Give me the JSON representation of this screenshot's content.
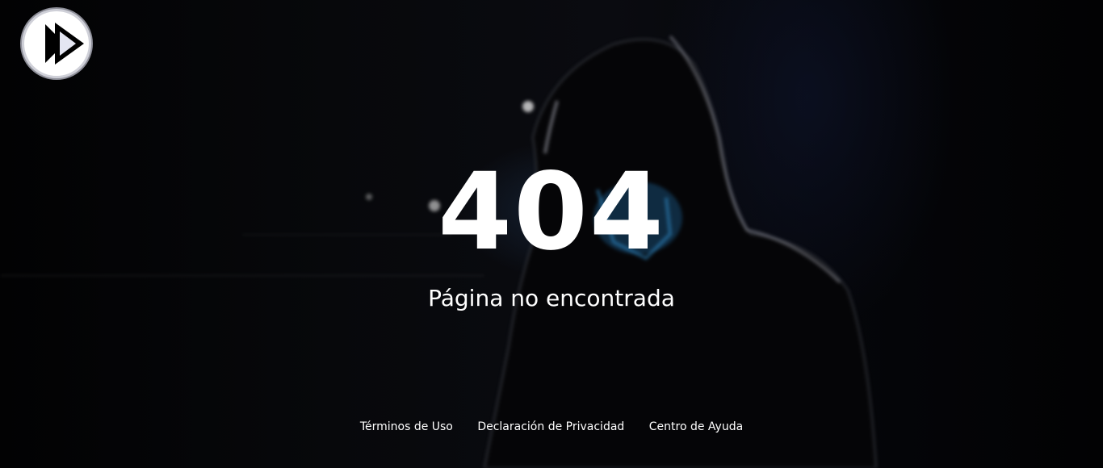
{
  "logo": {
    "icon": "play-logo-icon"
  },
  "error": {
    "code": "404",
    "message": "Página no encontrada"
  },
  "footer": {
    "links": [
      {
        "label": "Términos de Uso"
      },
      {
        "label": "Declaración de Privacidad"
      },
      {
        "label": "Centro de Ayuda"
      }
    ]
  },
  "colors": {
    "background": "#000000",
    "text": "#ffffff",
    "accent_glow": "#2a8fd6"
  }
}
